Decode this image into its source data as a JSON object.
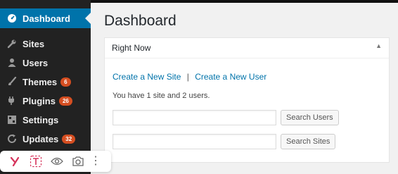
{
  "sidebar": {
    "items": [
      {
        "label": "Dashboard",
        "icon": "dashboard-icon",
        "active": true
      },
      {
        "label": "Sites",
        "icon": "wrench-icon"
      },
      {
        "label": "Users",
        "icon": "user-icon"
      },
      {
        "label": "Themes",
        "icon": "paintbrush-icon",
        "badge": "6"
      },
      {
        "label": "Plugins",
        "icon": "plug-icon",
        "badge": "26"
      },
      {
        "label": "Settings",
        "icon": "settings-icon"
      },
      {
        "label": "Updates",
        "icon": "refresh-icon",
        "badge": "32"
      }
    ]
  },
  "main": {
    "page_title": "Dashboard",
    "widget": {
      "title": "Right Now",
      "toggle": "▲",
      "link_create_site": "Create a New Site",
      "separator": "|",
      "link_create_user": "Create a New User",
      "summary": "You have 1 site and 2 users.",
      "search_users_label": "Search Users",
      "search_sites_label": "Search Sites"
    }
  },
  "toolbar": {
    "items": [
      "yoast-icon",
      "text-tool-icon",
      "eye-icon",
      "camera-icon",
      "more-icon"
    ],
    "more_label": "⋮"
  },
  "colors": {
    "sidebar_bg": "#222222",
    "active_bg": "#0073aa",
    "link": "#0073aa",
    "badge": "#d54e21",
    "yoast": "#d6335b"
  }
}
